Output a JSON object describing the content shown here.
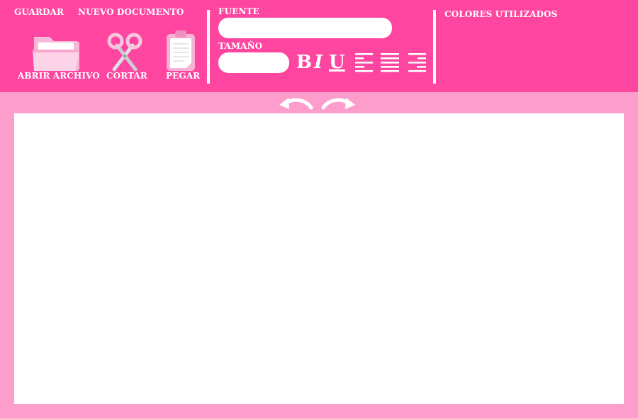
{
  "menu": {
    "save_label": "GUARDAR",
    "new_document_label": "NUEVO DOCUMENTO"
  },
  "tools": {
    "open_file_label": "ABRIR ARCHIVO",
    "cut_label": "CORTAR",
    "paste_label": "PEGAR"
  },
  "font_panel": {
    "font_label": "FUENTE",
    "font_value": "",
    "size_label": "TAMAÑO",
    "size_value": "",
    "bold_glyph": "B",
    "italic_glyph": "I",
    "underline_glyph": "U"
  },
  "colors_panel": {
    "label": "COLORES UTILIZADOS"
  },
  "icons": [
    "folder-icon",
    "scissors-icon",
    "clipboard-icon",
    "align-left-icon",
    "align-justify-icon",
    "align-right-icon",
    "undo-icon",
    "redo-icon"
  ],
  "theme": {
    "toolbar_bg": "#fe45a0",
    "page_bg": "#fd9dcb",
    "canvas_bg": "#ffffff",
    "text_color": "#ffffff"
  }
}
